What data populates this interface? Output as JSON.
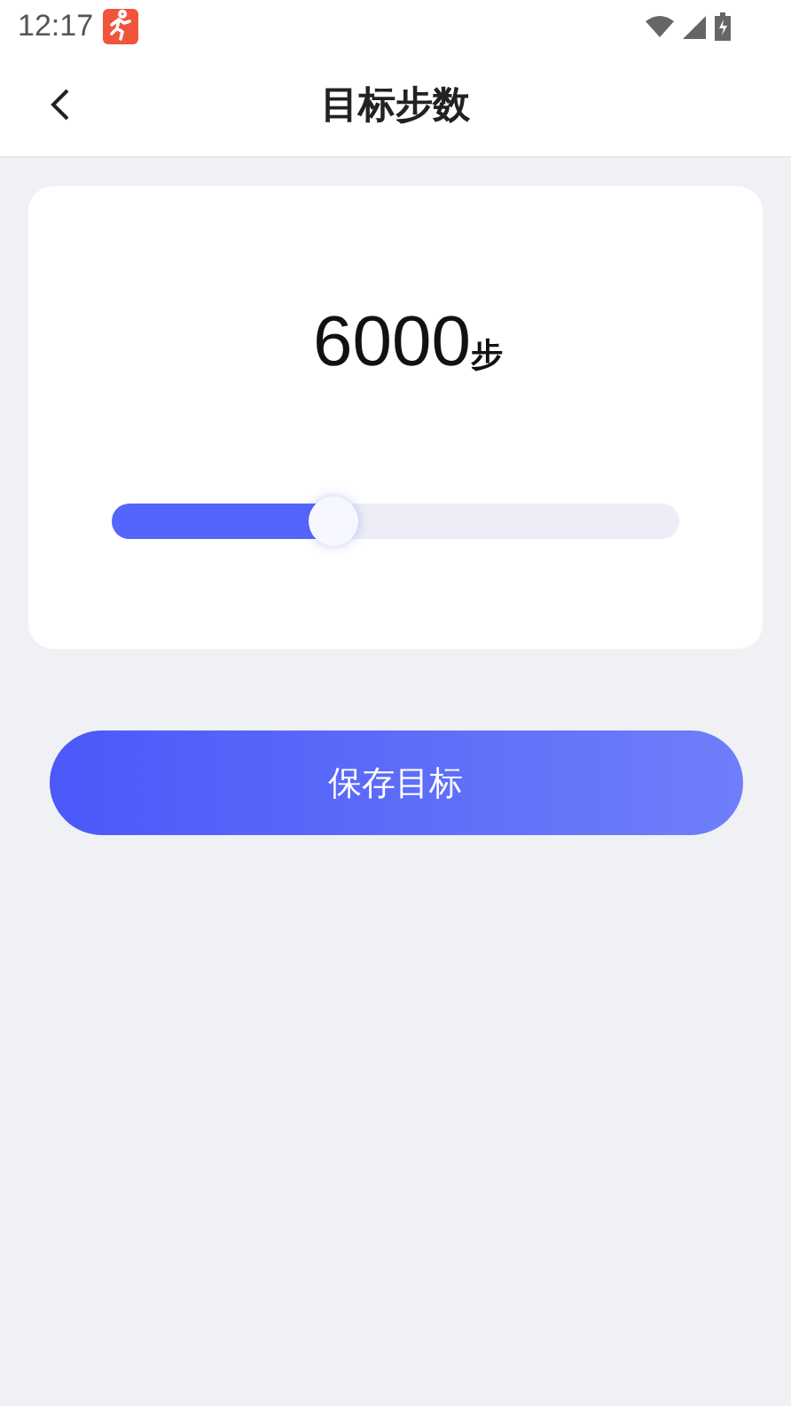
{
  "status_bar": {
    "time": "12:17"
  },
  "header": {
    "title": "目标步数"
  },
  "goal": {
    "value": "6000",
    "unit": "步",
    "slider": {
      "level": 0.39
    }
  },
  "save_button": {
    "label": "保存目标"
  }
}
